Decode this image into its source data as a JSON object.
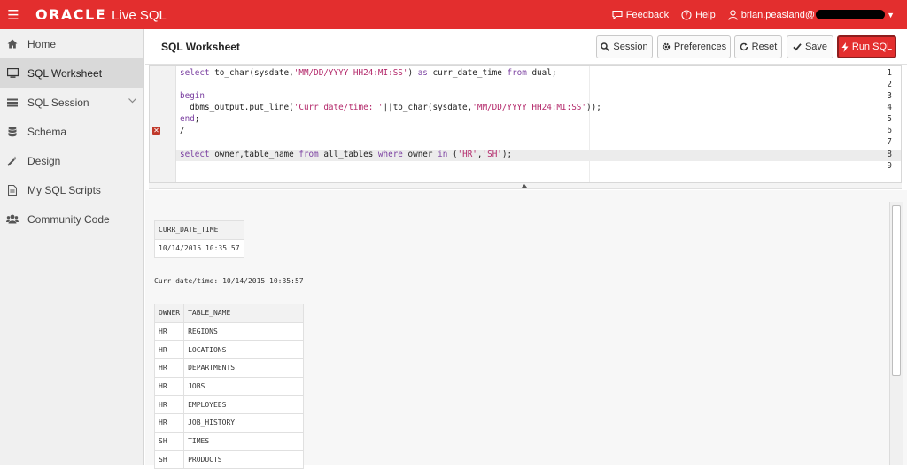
{
  "brand": {
    "oracle": "ORACLE",
    "product": "Live SQL"
  },
  "header_links": {
    "feedback": "Feedback",
    "help": "Help",
    "user": "brian.peasland@"
  },
  "sidebar": {
    "items": [
      {
        "label": "Home",
        "icon": "home-icon"
      },
      {
        "label": "SQL Worksheet",
        "icon": "monitor-icon",
        "active": true
      },
      {
        "label": "SQL Session",
        "icon": "list-icon",
        "expandable": true
      },
      {
        "label": "Schema",
        "icon": "database-icon"
      },
      {
        "label": "Design",
        "icon": "wand-icon"
      },
      {
        "label": "My SQL Scripts",
        "icon": "document-icon"
      },
      {
        "label": "Community Code",
        "icon": "users-icon"
      }
    ]
  },
  "worksheet": {
    "title": "SQL Worksheet",
    "buttons": {
      "session": "Session",
      "preferences": "Preferences",
      "reset": "Reset",
      "save": "Save",
      "run": "Run SQL"
    }
  },
  "editor": {
    "line_numbers": [
      "1",
      "2",
      "3",
      "4",
      "5",
      "6",
      "7",
      "8",
      "9"
    ],
    "error_line": "6",
    "active_line": "8",
    "lines": [
      "select to_char(sysdate,'MM/DD/YYYY HH24:MI:SS') as curr_date_time from dual;",
      "",
      "begin",
      "  dbms_output.put_line('Curr date/time: '||to_char(sysdate,'MM/DD/YYYY HH24:MI:SS'));",
      "end;",
      "/",
      "",
      "select owner,table_name from all_tables where owner in ('HR','SH');",
      ""
    ]
  },
  "results": {
    "query1": {
      "columns": [
        "CURR_DATE_TIME"
      ],
      "rows": [
        [
          "10/14/2015 10:35:57"
        ]
      ]
    },
    "dbms_output": "Curr date/time: 10/14/2015 10:35:57",
    "query2": {
      "columns": [
        "OWNER",
        "TABLE_NAME"
      ],
      "rows": [
        [
          "HR",
          "REGIONS"
        ],
        [
          "HR",
          "LOCATIONS"
        ],
        [
          "HR",
          "DEPARTMENTS"
        ],
        [
          "HR",
          "JOBS"
        ],
        [
          "HR",
          "EMPLOYEES"
        ],
        [
          "HR",
          "JOB_HISTORY"
        ],
        [
          "SH",
          "TIMES"
        ],
        [
          "SH",
          "PRODUCTS"
        ]
      ]
    }
  },
  "colors": {
    "brand_red": "#e32e2e",
    "keyword": "#7a3fa0",
    "string": "#b3286a"
  }
}
